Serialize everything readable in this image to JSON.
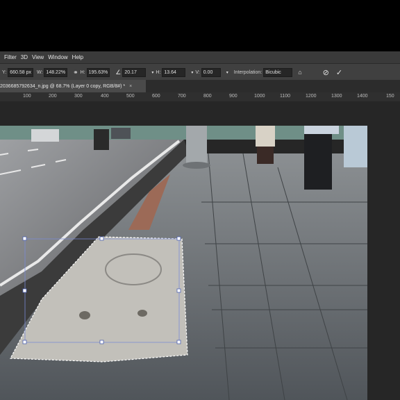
{
  "menu": [
    "Filter",
    "3D",
    "View",
    "Window",
    "Help"
  ],
  "options": {
    "x_value": "660.58 px",
    "w_label": "W:",
    "w_value": "148.22%",
    "h_label": "H:",
    "h_value": "195.63%",
    "angle_value": "20.17",
    "hskew_label": "H:",
    "hskew_value": "13.64",
    "vskew_label": "V:",
    "vskew_value": "0.00",
    "interp_label": "Interpolation:",
    "interp_value": "Bicubic"
  },
  "tab": {
    "title": "2036685792634_n.jpg @ 68.7% (Layer 0 copy, RGB/8#) *",
    "close": "×"
  },
  "ruler_ticks": [
    "100",
    "200",
    "300",
    "400",
    "500",
    "600",
    "700",
    "800",
    "900",
    "1000",
    "1100",
    "1200",
    "1300",
    "1400",
    "150"
  ]
}
